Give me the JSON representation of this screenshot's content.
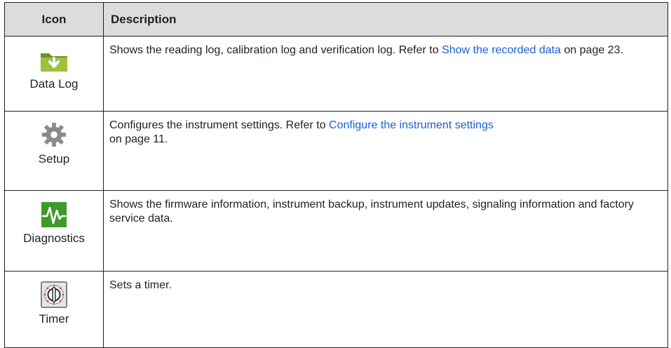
{
  "table": {
    "headers": {
      "icon": "Icon",
      "description": "Description"
    },
    "rows": [
      {
        "icon_name": "data-log-icon",
        "label": "Data Log",
        "desc_before": "Shows the reading log, calibration log and verification log. Refer to ",
        "link": "Show the recorded data",
        "desc_after": " on page 23."
      },
      {
        "icon_name": "gear-icon",
        "label": "Setup",
        "desc_before": "Configures the instrument settings. Refer to ",
        "link": "Configure the instrument settings",
        "desc_after": "on page 11."
      },
      {
        "icon_name": "waveform-icon",
        "label": "Diagnostics",
        "desc_before": "Shows the firmware information, instrument backup, instrument updates, signaling information and factory service data.",
        "link": "",
        "desc_after": ""
      },
      {
        "icon_name": "timer-dial-icon",
        "label": "Timer",
        "desc_before": "Sets a timer.",
        "link": "",
        "desc_after": ""
      }
    ]
  },
  "colors": {
    "link": "#1b5fd6",
    "header_bg": "#dcdcdd",
    "folder": "#8cae3a",
    "gear": "#8a8a8a",
    "diagnostics_bg": "#3e9b2a"
  }
}
